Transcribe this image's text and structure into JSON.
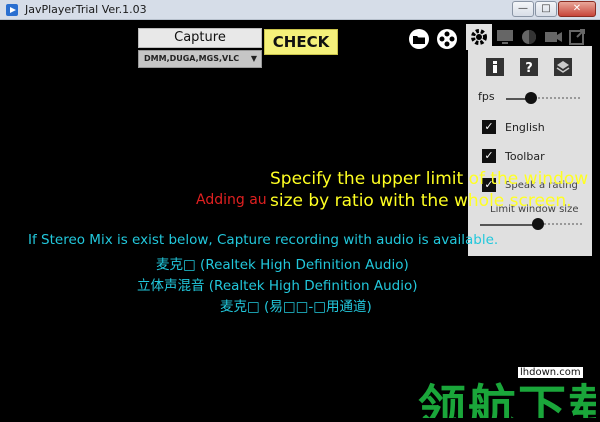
{
  "window": {
    "title": "JavPlayerTrial Ver.1.03",
    "minimize": "—",
    "maximize": "□",
    "close": "✕"
  },
  "toolbar": {
    "capture_label": "Capture",
    "check_label": "CHECK",
    "site_select_value": "DMM,DUGA,MGS,VLC",
    "icons": [
      "folder-icon",
      "film-reel-icon"
    ]
  },
  "settings_panel": {
    "tabs": [
      "gear-icon",
      "monitor-icon",
      "half-circle-icon",
      "camera-icon",
      "export-icon"
    ],
    "square_icons": [
      "info-icon",
      "help-icon",
      "layers-icon"
    ],
    "fps_label": "fps",
    "fps_level": 0.3,
    "checkboxes": [
      {
        "label": "English",
        "checked": true
      },
      {
        "label": "Toolbar",
        "checked": true
      },
      {
        "label": "Speak a rating",
        "checked": true
      }
    ],
    "window_size_label": "Limit window size",
    "window_size_level": 0.6
  },
  "tooltip": {
    "line1": "Specify the upper limit of the window",
    "line2": "size by ratio with the whole screen."
  },
  "status": {
    "adding_audio": "Adding au",
    "stereo_mix_note": "If Stereo Mix is exist below, Capture recording with audio is available.",
    "device1": "麦克□ (Realtek High Definition Audio)",
    "device2": "立体声混音 (Realtek High Definition Audio)",
    "device3": "麦克□ (易□□-□用通道)"
  },
  "watermark": {
    "text": "领航下载",
    "site": "lhdown.com"
  },
  "colors": {
    "tooltip": "#ffff22",
    "status_red": "#e02020",
    "status_cyan": "#22c8dc",
    "check_button": "#f5f17a",
    "watermark": "#1aa63a"
  }
}
